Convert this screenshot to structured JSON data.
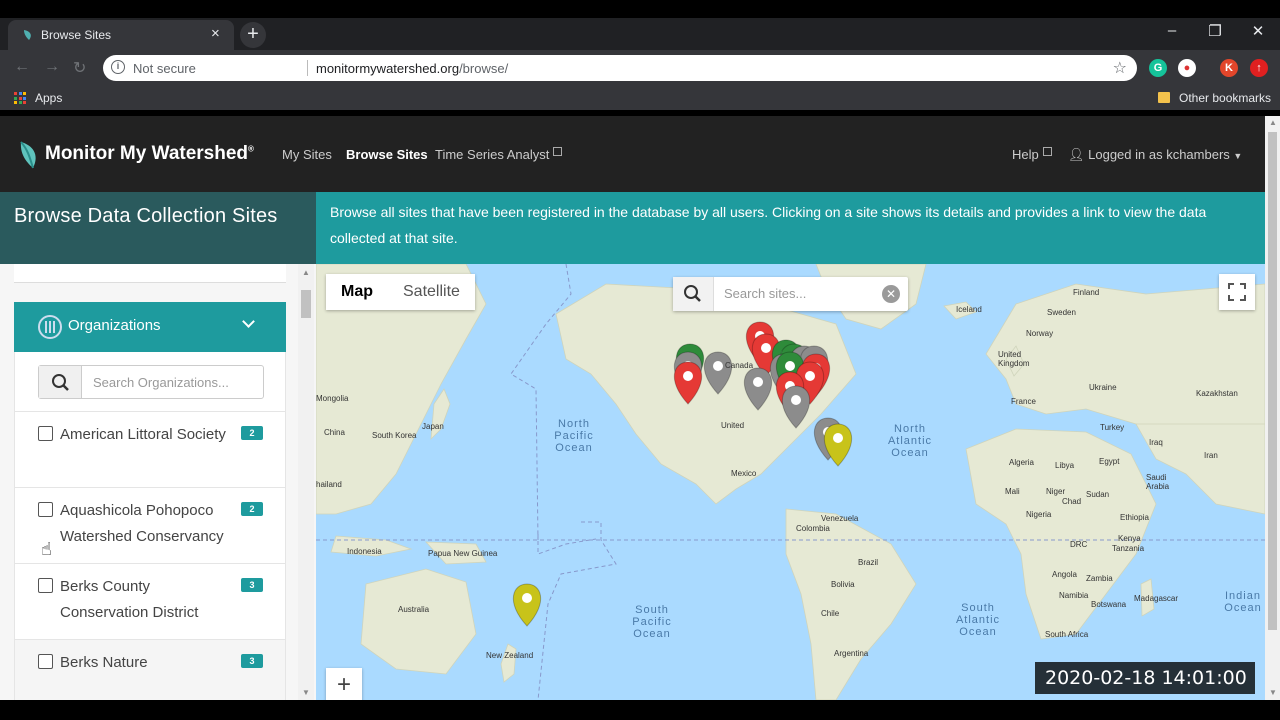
{
  "browser": {
    "tab_title": "Browse Sites",
    "tab_close": "×",
    "new_tab": "+",
    "security": "Not secure",
    "url_domain": "monitormywatershed.org",
    "url_path": "/browse/",
    "bookmark_apps": "Apps",
    "bookmark_other": "Other bookmarks",
    "profile_initial": "K"
  },
  "navbar": {
    "brand": "Monitor My Watershed",
    "brand_mark": "®",
    "links": [
      "My Sites",
      "Browse Sites",
      "Time Series Analyst"
    ],
    "help": "Help",
    "user": "Logged in as kchambers"
  },
  "header": {
    "title": "Browse Data Collection Sites",
    "description": "Browse all sites that have been registered in the database by all users. Clicking on a site shows its details and provides a link to view the data collected at that site."
  },
  "sidebar": {
    "section_title": "Organizations",
    "search_placeholder": "Search Organizations...",
    "organizations": [
      {
        "name": "American Littoral Society",
        "count": "2"
      },
      {
        "name": "Aquashicola Pohopoco Watershed Conservancy",
        "count": "2"
      },
      {
        "name": "Berks County Conservation District",
        "count": "3"
      },
      {
        "name": "Berks Nature",
        "count": "3"
      }
    ]
  },
  "map": {
    "type_buttons": [
      "Map",
      "Satellite"
    ],
    "active_type": "Map",
    "search_placeholder": "Search sites...",
    "zoom_in": "+",
    "labels": [
      "Mongolia",
      "China",
      "South Korea",
      "Japan",
      "Indonesia",
      "Papua New Guinea",
      "Australia",
      "New Zealand",
      "Canada",
      "United",
      "Mexico",
      "Colombia",
      "Venezuela",
      "Brazil",
      "Bolivia",
      "Chile",
      "Argentina",
      "Iceland",
      "Finland",
      "Sweden",
      "Norway",
      "United Kingdom",
      "France",
      "Ukraine",
      "Kazakhstan",
      "Turkey",
      "Iraq",
      "Iran",
      "Algeria",
      "Libya",
      "Egypt",
      "Saudi Arabia",
      "Mali",
      "Niger",
      "Chad",
      "Sudan",
      "Nigeria",
      "Ethiopia",
      "DRC",
      "Kenya",
      "Tanzania",
      "Angola",
      "Zambia",
      "Namibia",
      "Botswana",
      "Madagascar",
      "South Africa",
      "hailand"
    ],
    "oceans": [
      "North Pacific Ocean",
      "North Atlantic Ocean",
      "South Pacific Ocean",
      "South Atlantic Ocean",
      "Indian Ocean"
    ]
  },
  "overlay": {
    "timestamp": "2020-02-18  14:01:00"
  },
  "colors": {
    "teal": "#1e9b9e",
    "dark_teal": "#2a5a5d",
    "navbar": "#222222",
    "pin_red": "#e53935",
    "pin_green": "#2e8b3a",
    "pin_gray": "#8c8c8c",
    "pin_yellow": "#c8c31a",
    "ocean": "#aadaff",
    "land": "#e8ead8"
  }
}
